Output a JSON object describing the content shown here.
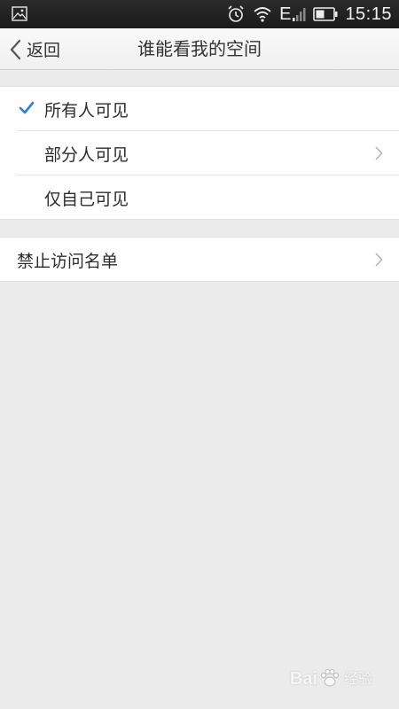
{
  "status_bar": {
    "time": "15:15",
    "network": "E",
    "icons": [
      "image-icon",
      "alarm-icon",
      "wifi-icon",
      "signal-icon",
      "battery-icon"
    ]
  },
  "header": {
    "back_label": "返回",
    "title": "谁能看我的空间"
  },
  "visibility_options": [
    {
      "label": "所有人可见",
      "selected": true,
      "has_arrow": false
    },
    {
      "label": "部分人可见",
      "selected": false,
      "has_arrow": true
    },
    {
      "label": "仅自己可见",
      "selected": false,
      "has_arrow": false
    }
  ],
  "blocklist": {
    "label": "禁止访问名单"
  },
  "watermark": {
    "brand_left": "Bai",
    "brand_right": "经验"
  },
  "colors": {
    "accent": "#2a7fe0",
    "background": "#ebebeb",
    "status_bar": "#1e1e1e"
  }
}
